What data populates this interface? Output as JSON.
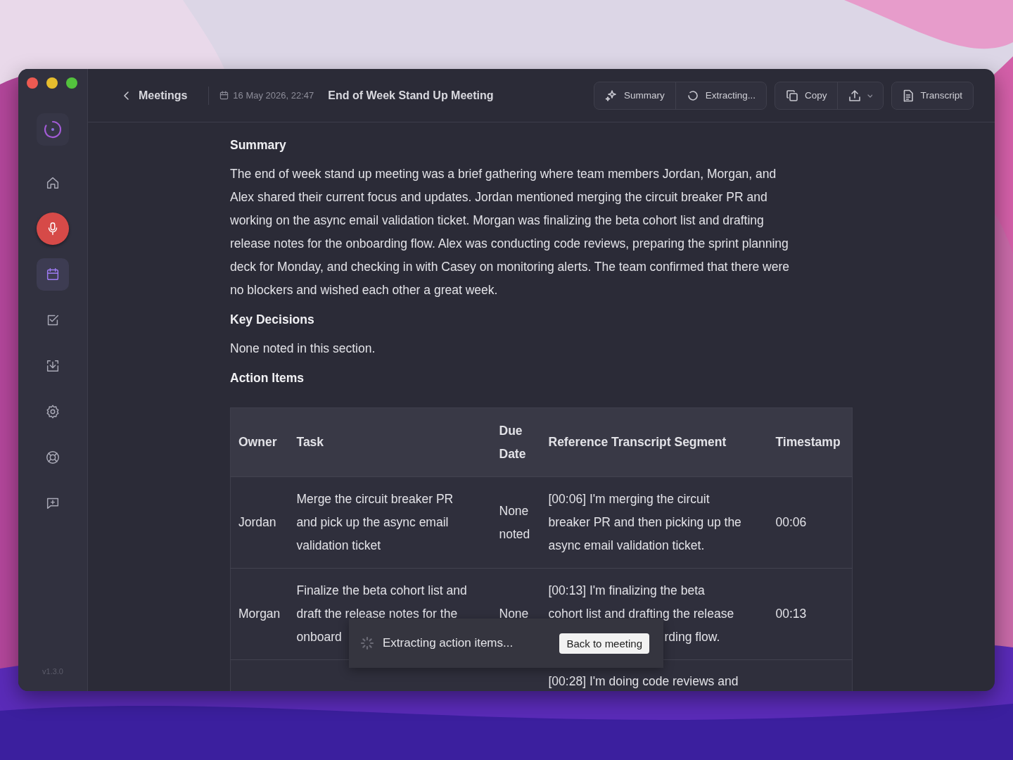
{
  "sidebar": {
    "items": [
      {
        "selected": false
      },
      {
        "selected": false
      },
      {
        "selected": true
      },
      {
        "selected": false
      },
      {
        "selected": false
      },
      {
        "selected": false
      },
      {
        "selected": false
      },
      {
        "selected": false
      }
    ],
    "version": "v1.3.0"
  },
  "header": {
    "back": "Meetings",
    "date": "16 May 2026, 22:47",
    "title": "End of Week Stand Up Meeting",
    "buttons": [
      {
        "label": "Summary"
      },
      {
        "label": "Extracting..."
      },
      {
        "label": "Copy"
      },
      {
        "label": "Transcript"
      }
    ]
  },
  "content": {
    "summary_heading": "Summary",
    "summary": "The end of week stand up meeting was a brief gathering where team members Jordan, Morgan, and Alex shared their current focus and updates. Jordan mentioned merging the circuit breaker PR and working on the async email validation ticket. Morgan was finalizing the beta cohort list and drafting release notes for the onboarding flow. Alex was conducting code reviews, preparing the sprint planning deck for Monday, and checking in with Casey on monitoring alerts. The team confirmed that there were no blockers and wished each other a great week.",
    "decisions_heading": "Key Decisions",
    "decisions": "None noted in this section.",
    "actions_heading": "Action Items",
    "table": {
      "columns": [
        "Owner",
        "Task",
        "Due\nDate",
        "Reference Transcript Segment",
        "Timestamp"
      ],
      "rows": [
        {
          "owner": "Jordan",
          "task": "Merge the circuit breaker PR\nand pick up the async email\nvalidation ticket",
          "due": "None\nnoted",
          "reference": "[00:06] I'm merging the circuit\nbreaker PR and then picking up the\nasync email validation ticket.",
          "timestamp": "00:06"
        },
        {
          "owner": "Morgan",
          "task": "Finalize the beta cohort list and\ndraft the release notes for the\nonboard",
          "due": "None",
          "reference": "[00:13] I'm finalizing the beta\ncohort list and drafting the release",
          "reference_tail": "rding flow.",
          "timestamp": "00:13"
        },
        {
          "reference": "[00:28] I'm doing code reviews and"
        }
      ]
    }
  },
  "toast": {
    "text": "Extracting action items...",
    "button": "Back to meeting"
  }
}
